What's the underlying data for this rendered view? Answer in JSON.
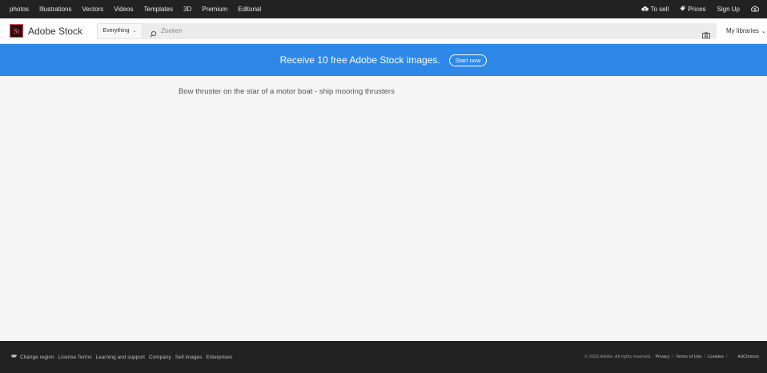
{
  "topnav": {
    "left_items": [
      "photos",
      "Illustrations",
      "Vectors",
      "Videos",
      "Templates",
      "3D",
      "Premium",
      "Editorial"
    ],
    "sell": "To sell",
    "prices": "Prices",
    "signup": "Sign Up",
    "sell_icon": "cloud-upload-icon",
    "prices_icon": "tag-icon",
    "account_icon": "creative-cloud-icon"
  },
  "header": {
    "logo_badge": "St",
    "logo_text": "Adobe Stock",
    "search_scope": "Everything",
    "search_placeholder": "Zoeken",
    "search_value": "",
    "libraries": "My libraries"
  },
  "promo": {
    "text": "Receive 10 free Adobe Stock images.",
    "button": "Start now",
    "color": "#2d88e8"
  },
  "main": {
    "title": "Bow thruster on the star of a motor boat - ship mooring thrusters"
  },
  "footer": {
    "change_region": "Change region",
    "links": [
      "License Terms",
      "Learning and support",
      "Company",
      "Sell images",
      "Enterprises"
    ],
    "copyright": "© 2020 Adobe. All rights reserved.",
    "legal": [
      "Privacy",
      "Terms of Use",
      "Cookies"
    ],
    "adchoices": "AdChoices"
  }
}
